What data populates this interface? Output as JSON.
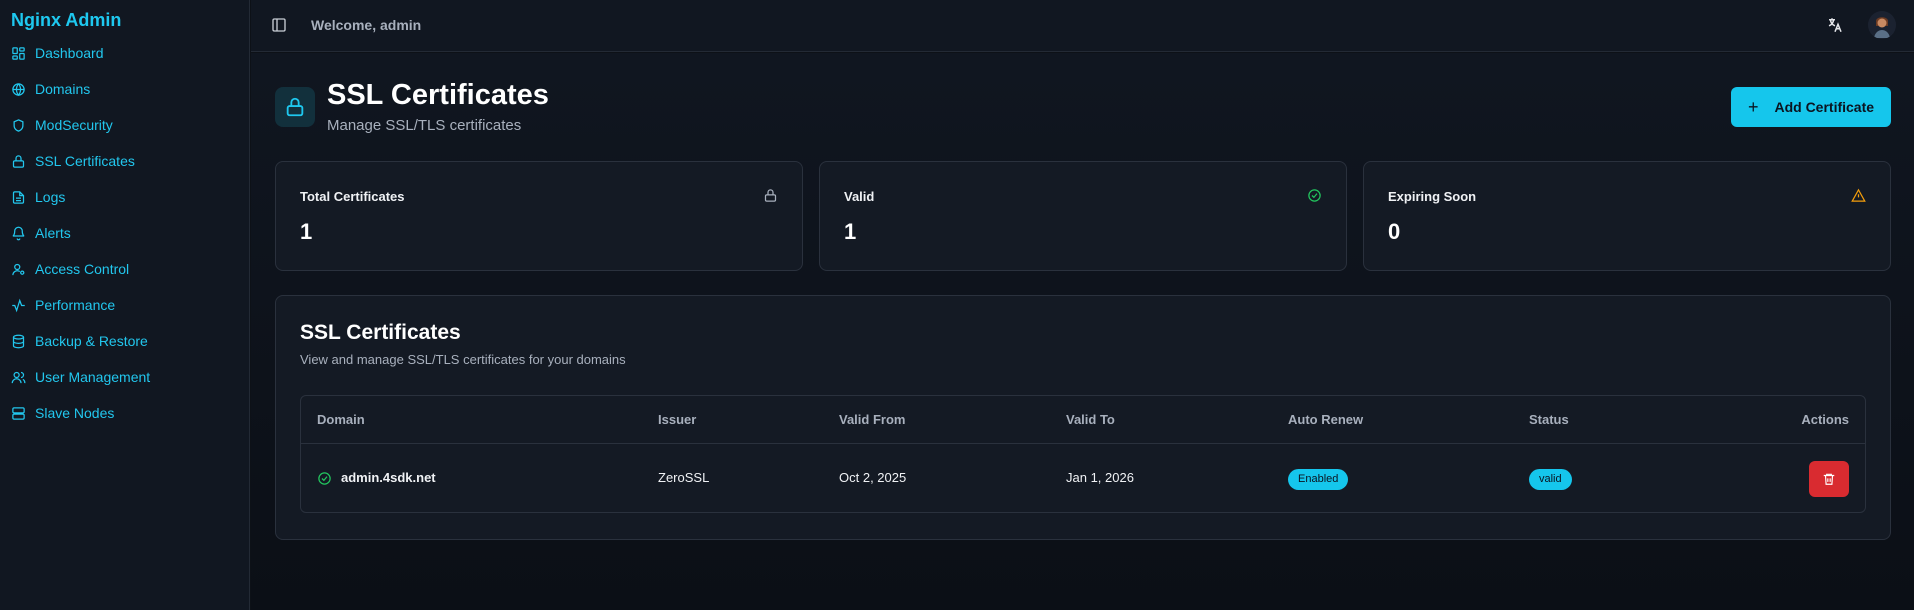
{
  "app": {
    "brand": "Nginx Admin"
  },
  "sidebar": {
    "items": [
      {
        "label": "Dashboard",
        "icon": "dashboard-icon"
      },
      {
        "label": "Domains",
        "icon": "globe-icon"
      },
      {
        "label": "ModSecurity",
        "icon": "shield-icon"
      },
      {
        "label": "SSL Certificates",
        "icon": "lock-icon"
      },
      {
        "label": "Logs",
        "icon": "file-text-icon"
      },
      {
        "label": "Alerts",
        "icon": "bell-icon"
      },
      {
        "label": "Access Control",
        "icon": "user-key-icon"
      },
      {
        "label": "Performance",
        "icon": "activity-icon"
      },
      {
        "label": "Backup & Restore",
        "icon": "database-icon"
      },
      {
        "label": "User Management",
        "icon": "users-icon"
      },
      {
        "label": "Slave Nodes",
        "icon": "server-icon"
      }
    ]
  },
  "header": {
    "welcome": "Welcome, admin"
  },
  "page": {
    "title": "SSL Certificates",
    "subtitle": "Manage SSL/TLS certificates",
    "add_button": "Add Certificate"
  },
  "stats": [
    {
      "label": "Total Certificates",
      "value": "1",
      "icon": "lock-icon"
    },
    {
      "label": "Valid",
      "value": "1",
      "icon": "check-circle-icon"
    },
    {
      "label": "Expiring Soon",
      "value": "0",
      "icon": "warning-icon"
    }
  ],
  "table": {
    "title": "SSL Certificates",
    "subtitle": "View and manage SSL/TLS certificates for your domains",
    "columns": [
      "Domain",
      "Issuer",
      "Valid From",
      "Valid To",
      "Auto Renew",
      "Status",
      "Actions"
    ],
    "rows": [
      {
        "domain": "admin.4sdk.net",
        "issuer": "ZeroSSL",
        "valid_from": "Oct 2, 2025",
        "valid_to": "Jan 1, 2026",
        "auto_renew": "Enabled",
        "status": "valid"
      }
    ]
  },
  "colors": {
    "accent": "#15c6ec",
    "valid": "#22c55e",
    "warning": "#f59e0b",
    "danger": "#d92b30",
    "background": "#0d1117"
  }
}
